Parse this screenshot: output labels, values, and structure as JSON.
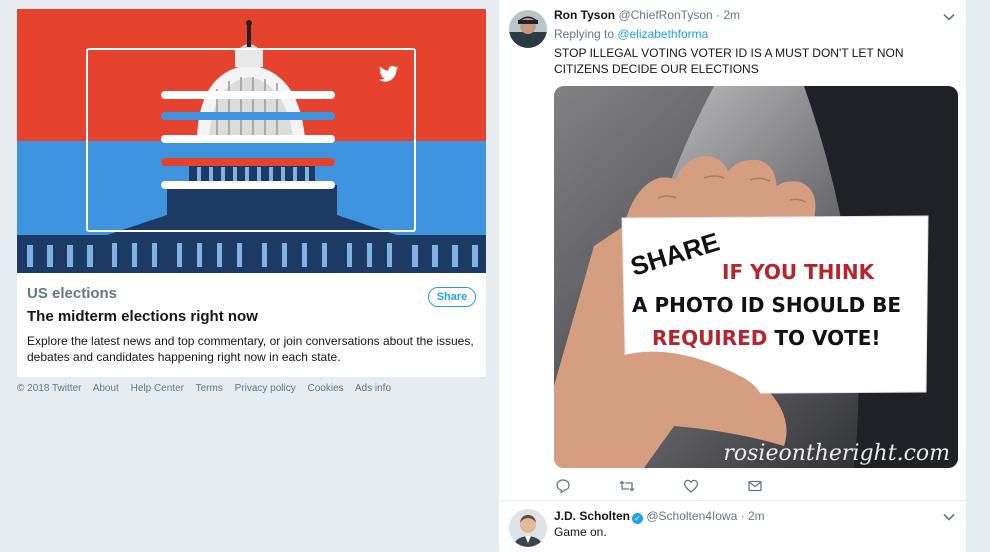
{
  "event_card": {
    "category": "US elections",
    "share_label": "Share",
    "title": "The midterm elections right now",
    "description": "Explore the latest news and top commentary, or join conversations about the issues, debates and candidates happening right now in each state."
  },
  "footer": {
    "copyright": "© 2018 Twitter",
    "links": [
      "About",
      "Help Center",
      "Terms",
      "Privacy policy",
      "Cookies",
      "Ads info"
    ]
  },
  "tweets": [
    {
      "name": "Ron Tyson",
      "handle": "@ChiefRonTyson",
      "separator": "·",
      "time": "2m",
      "replying_prefix": "Replying to",
      "replying_to": "@elizabethforma",
      "text": "STOP ILLEGAL VOTING VOTER ID IS A MUST DON'T LET NON CITIZENS DECIDE OUR ELECTIONS",
      "media": {
        "share": "SHARE",
        "line1": "IF YOU THINK",
        "line2": "A PHOTO ID SHOULD BE",
        "line3a": "REQUIRED",
        "line3b": " TO VOTE!",
        "watermark": "rosieontheright.com"
      }
    },
    {
      "name": "J.D. Scholten",
      "verified": true,
      "handle": "@Scholten4Iowa",
      "separator": "·",
      "time": "2m",
      "text": "Game on."
    }
  ],
  "icons": {
    "actions": [
      "reply-icon",
      "retweet-icon",
      "like-icon",
      "message-icon"
    ],
    "chevron": "chevron-down-icon",
    "twitter_logo": "twitter-bird-icon"
  },
  "colors": {
    "accent": "#1da1f2",
    "card_red": "#e5432e",
    "card_blue": "#3f94e0",
    "page_bg": "#e6ecf0",
    "media_red": "#b8242c"
  }
}
